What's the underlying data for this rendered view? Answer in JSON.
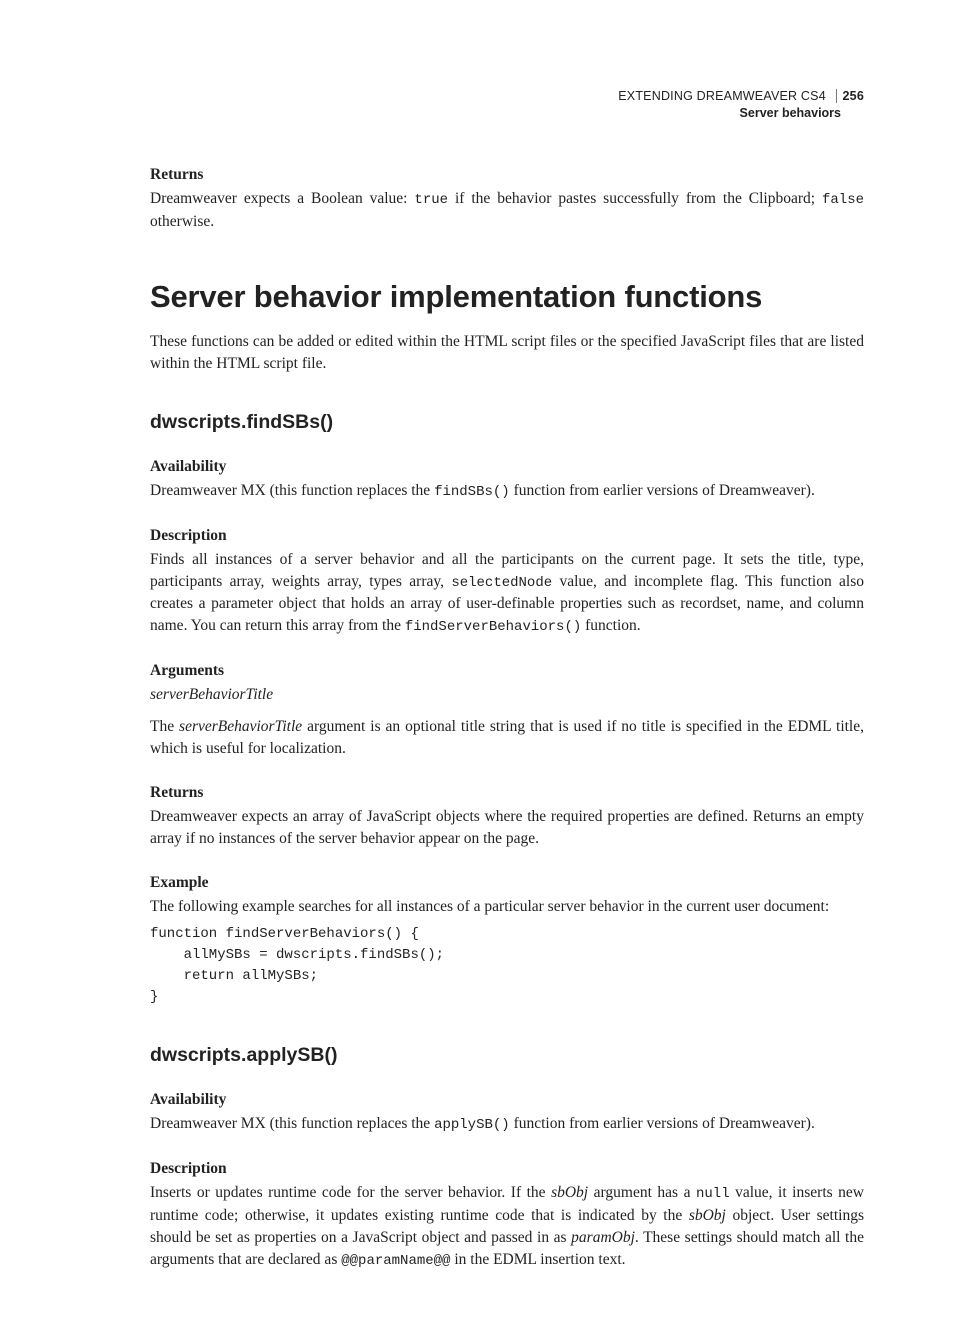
{
  "header": {
    "book": "EXTENDING DREAMWEAVER CS4",
    "page_number": "256",
    "section": "Server behaviors"
  },
  "returns_top": {
    "heading": "Returns",
    "text_before_true": "Dreamweaver expects a Boolean value: ",
    "code_true": "true",
    "text_middle": " if the behavior pastes successfully from the Clipboard; ",
    "code_false": "false",
    "text_after": " otherwise."
  },
  "h1": "Server behavior implementation functions",
  "intro": "These functions can be added or edited within the HTML script files or the specified JavaScript files that are listed within the HTML script file.",
  "findSBs": {
    "title": "dwscripts.findSBs()",
    "availability": {
      "heading": "Availability",
      "pre": "Dreamweaver MX (this function replaces the ",
      "code": "findSBs()",
      "post": " function from earlier versions of Dreamweaver)."
    },
    "description": {
      "heading": "Description",
      "pre": "Finds all instances of a server behavior and all the participants on the current page. It sets the title, type, participants array, weights array, types array, ",
      "code1": "selectedNode",
      "mid": " value, and incomplete flag. This function also creates a parameter object that holds an array of user-definable properties such as recordset, name, and column name. You can return this array from the ",
      "code2": "findServerBehaviors()",
      "post": " function."
    },
    "arguments": {
      "heading": "Arguments",
      "arg_name": "serverBehaviorTitle",
      "expl_pre": "The ",
      "expl_em": "serverBehaviorTitle",
      "expl_post": " argument is an optional title string that is used if no title is specified in the EDML title, which is useful for localization."
    },
    "returns": {
      "heading": "Returns",
      "text": "Dreamweaver expects an array of JavaScript objects where the required properties are defined. Returns an empty array if no instances of the server behavior appear on the page."
    },
    "example": {
      "heading": "Example",
      "text": "The following example searches for all instances of a particular server behavior in the current user document:",
      "code": "function findServerBehaviors() {\n    allMySBs = dwscripts.findSBs();\n    return allMySBs;\n}"
    }
  },
  "applySB": {
    "title": "dwscripts.applySB()",
    "availability": {
      "heading": "Availability",
      "pre": "Dreamweaver MX (this function replaces the ",
      "code": "applySB()",
      "post": " function from earlier versions of Dreamweaver)."
    },
    "description": {
      "heading": "Description",
      "t1": "Inserts or updates runtime code for the server behavior. If the ",
      "em1": "sbObj",
      "t2": " argument has a ",
      "code1": "null",
      "t3": " value, it inserts new runtime code; otherwise, it updates existing runtime code that is indicated by the ",
      "em2": "sbObj",
      "t4": " object. User settings should be set as properties on a JavaScript object and passed in as ",
      "em3": "paramObj",
      "t5": ". These settings should match all the arguments that are declared as ",
      "code2": "@@paramName@@",
      "t6": " in the EDML insertion text."
    }
  }
}
